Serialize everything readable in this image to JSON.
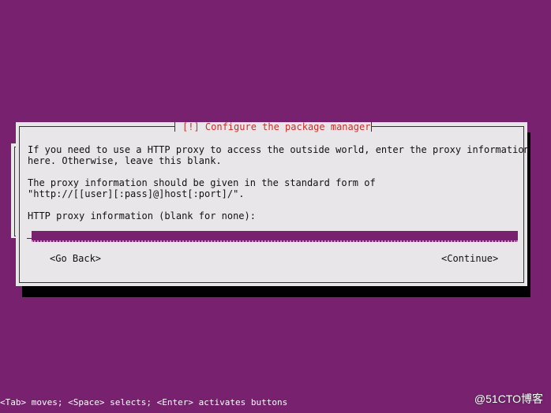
{
  "dialog": {
    "title": "[!] Configure the package manager",
    "paragraph1_line1": "If you need to use a HTTP proxy to access the outside world, enter the proxy information",
    "paragraph1_line2": "here. Otherwise, leave this blank.",
    "paragraph2_line1": "The proxy information should be given in the standard form of",
    "paragraph2_line2": "\"http://[[user][:pass]@]host[:port]/\".",
    "field_label": "HTTP proxy information (blank for none):",
    "field_value": "",
    "go_back_label": "<Go Back>",
    "continue_label": "<Continue>"
  },
  "status_bar": {
    "hint": "<Tab> moves; <Space> selects; <Enter> activates buttons"
  },
  "watermark": "@51CTO博客",
  "colors": {
    "background": "#77216f",
    "dialog": "#e8e6e8",
    "title": "#c9302c",
    "input": "#77216f"
  }
}
